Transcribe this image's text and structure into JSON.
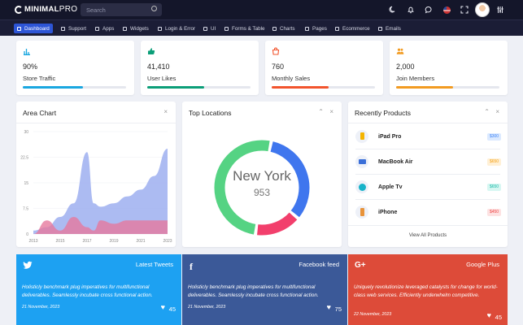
{
  "brand": {
    "logo_main": "MINIMAL",
    "logo_pro": "PRO"
  },
  "search": {
    "placeholder": "Search"
  },
  "nav": [
    "Dashboard",
    "Support",
    "Apps",
    "Widgets",
    "Login & Error",
    "UI",
    "Forms & Table",
    "Charts",
    "Pages",
    "Ecommerce",
    "Emails"
  ],
  "stats": [
    {
      "value": "90%",
      "label": "Store Traffic",
      "progress": 0.58,
      "color": "#1aa7e0"
    },
    {
      "value": "41,410",
      "label": "User Likes",
      "progress": 0.55,
      "color": "#0b9e78"
    },
    {
      "value": "760",
      "label": "Monthly Sales",
      "progress": 0.55,
      "color": "#f2542d"
    },
    {
      "value": "2,000",
      "label": "Join Members",
      "progress": 0.55,
      "color": "#f29b21"
    }
  ],
  "area_chart": {
    "title": "Area Chart",
    "close": "×"
  },
  "chart_data": {
    "type": "area",
    "x": [
      2013,
      2014,
      2015,
      2016,
      2017,
      2017.5,
      2018,
      2019,
      2020,
      2021,
      2022,
      2023
    ],
    "xticks": [
      "2013",
      "2015",
      "2017",
      "2019",
      "2021",
      "2023"
    ],
    "yticks": [
      "0",
      "7.5",
      "15",
      "22.5",
      "30"
    ],
    "ylim": [
      0,
      30
    ],
    "series": [
      {
        "values": [
          1,
          2,
          5,
          9,
          24,
          9,
          8,
          9,
          11,
          13,
          17,
          25
        ],
        "color": "#9daff0"
      },
      {
        "values": [
          0,
          4,
          1,
          5,
          2,
          1,
          4,
          3,
          4,
          4,
          4,
          4
        ],
        "color": "#e6799d"
      }
    ]
  },
  "locations": {
    "title": "Top Locations",
    "center_label": "New York",
    "center_value": "953",
    "chevron": "⌃",
    "close": "×"
  },
  "donut": [
    {
      "fraction": 0.33,
      "color": "#3f76ee"
    },
    {
      "fraction": 0.16,
      "color": "#f23f6c"
    },
    {
      "fraction": 0.51,
      "color": "#55d383"
    }
  ],
  "products": {
    "title": "Recently Products",
    "chevron": "⌃",
    "close": "×",
    "items": [
      {
        "name": "iPad Pro",
        "price": "$300",
        "color": "#3b82f6",
        "bg": "#dceaff"
      },
      {
        "name": "MacBook Air",
        "price": "$650",
        "color": "#f59e0b",
        "bg": "#fff0d6"
      },
      {
        "name": "Apple Tv",
        "price": "$650",
        "color": "#14b8a6",
        "bg": "#d7f7f2"
      },
      {
        "name": "iPhone",
        "price": "$450",
        "color": "#ef4444",
        "bg": "#fde2e2"
      }
    ],
    "view_all": "View All Products"
  },
  "social": [
    {
      "title": "Latest Tweets",
      "icon": "twitter-icon",
      "icon_text": "🐦",
      "text": "Holisticly benchmark plug imperatives for multifunctional deliverables. Seamlessly incubate cross functional action.",
      "date": "21 November, 2023",
      "likes": "45",
      "color": "#1da1f2"
    },
    {
      "title": "Facebook feed",
      "icon": "facebook-icon",
      "icon_text": "f",
      "text": "Holisticly benchmark plug imperatives for multifunctional deliverables. Seamlessly incubate cross functional action.",
      "date": "21 November, 2023",
      "likes": "75",
      "color": "#3b5998"
    },
    {
      "title": "Google Plus",
      "icon": "google-plus-icon",
      "icon_text": "G+",
      "text": "Uniquely revolutionize leveraged catalysts for change for world-class web services. Efficiently underwhelm competitive.",
      "date": "22 November, 2023",
      "likes": "45",
      "color": "#dd4b39"
    }
  ]
}
